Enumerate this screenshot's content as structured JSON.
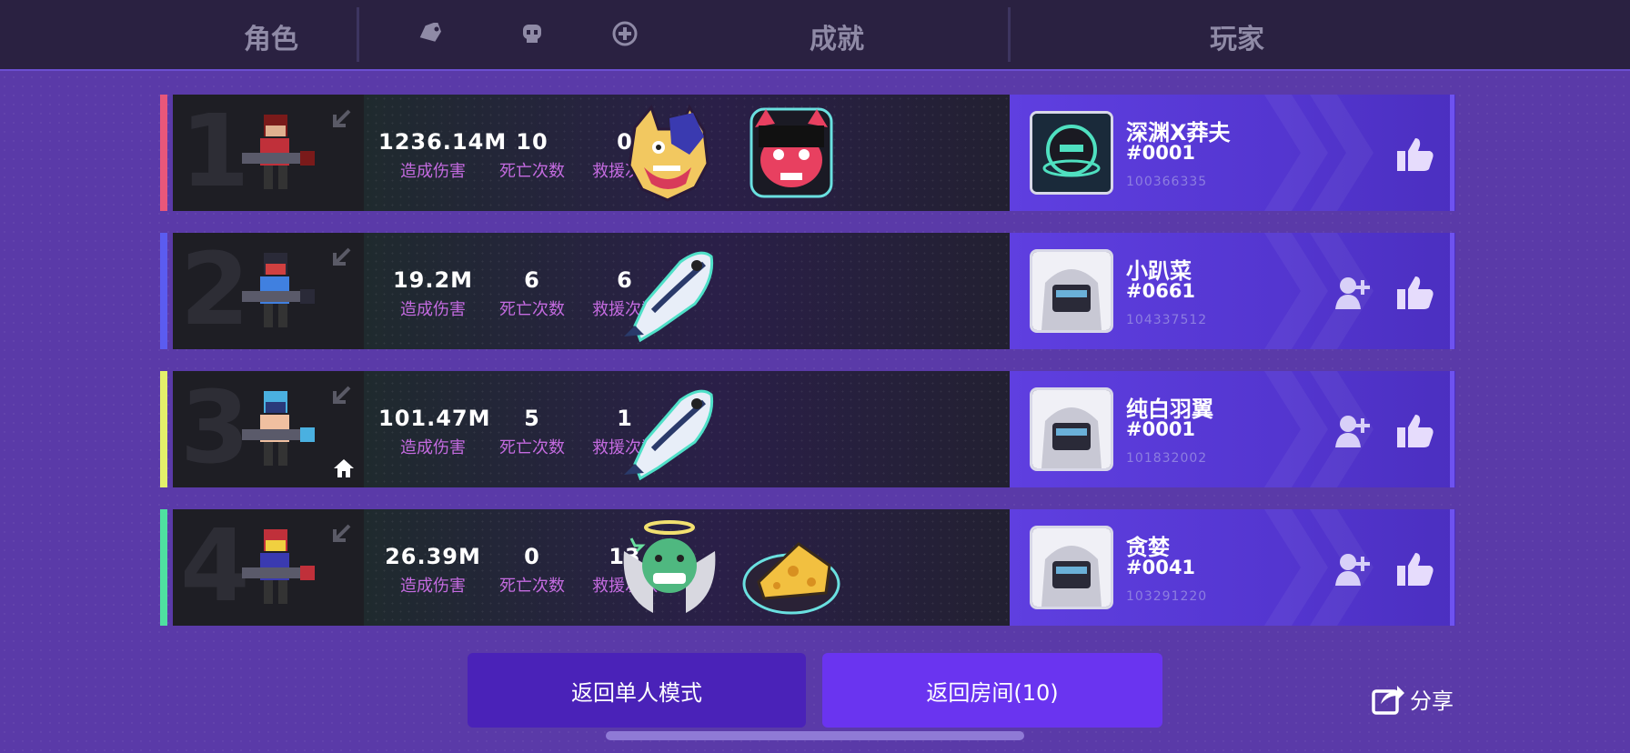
{
  "header": {
    "character_label": "角色",
    "achievement_label": "成就",
    "player_label": "玩家",
    "icons": [
      "tag-icon",
      "skull-icon",
      "medkit-icon"
    ]
  },
  "rows": [
    {
      "rank": "1",
      "accent_color": "#e8577a",
      "damage": "1236.14M",
      "damage_label": "造成伤害",
      "deaths": "10",
      "deaths_label": "死亡次数",
      "rescues": "0",
      "rescues_label": "救援次数",
      "badges": [
        "wolf-badge-icon",
        "red-demon-girl-badge-icon"
      ],
      "player": {
        "name": "深渊X莽夫",
        "tag": "#0001",
        "id": "100366335"
      },
      "host": false,
      "can_add_friend": false
    },
    {
      "rank": "2",
      "accent_color": "#5b5cf0",
      "damage": "19.2M",
      "damage_label": "造成伤害",
      "deaths": "6",
      "deaths_label": "死亡次数",
      "rescues": "6",
      "rescues_label": "救援次数",
      "badges": [
        "fish-badge-icon"
      ],
      "player": {
        "name": "小趴菜",
        "tag": "#0661",
        "id": "104337512"
      },
      "host": false,
      "can_add_friend": true
    },
    {
      "rank": "3",
      "accent_color": "#e4f06a",
      "damage": "101.47M",
      "damage_label": "造成伤害",
      "deaths": "5",
      "deaths_label": "死亡次数",
      "rescues": "1",
      "rescues_label": "救援次数",
      "badges": [
        "fish-badge-icon"
      ],
      "player": {
        "name": "纯白羽翼",
        "tag": "#0001",
        "id": "101832002"
      },
      "host": true,
      "can_add_friend": true
    },
    {
      "rank": "4",
      "accent_color": "#4fe0a0",
      "damage": "26.39M",
      "damage_label": "造成伤害",
      "deaths": "0",
      "deaths_label": "死亡次数",
      "rescues": "13",
      "rescues_label": "救援次数",
      "badges": [
        "angel-smile-badge-icon",
        "cheese-badge-icon"
      ],
      "player": {
        "name": "贪婪",
        "tag": "#0041",
        "id": "103291220"
      },
      "host": false,
      "can_add_friend": true
    }
  ],
  "buttons": {
    "back_single": "返回单人模式",
    "back_room": "返回房间(10)",
    "share": "分享"
  }
}
